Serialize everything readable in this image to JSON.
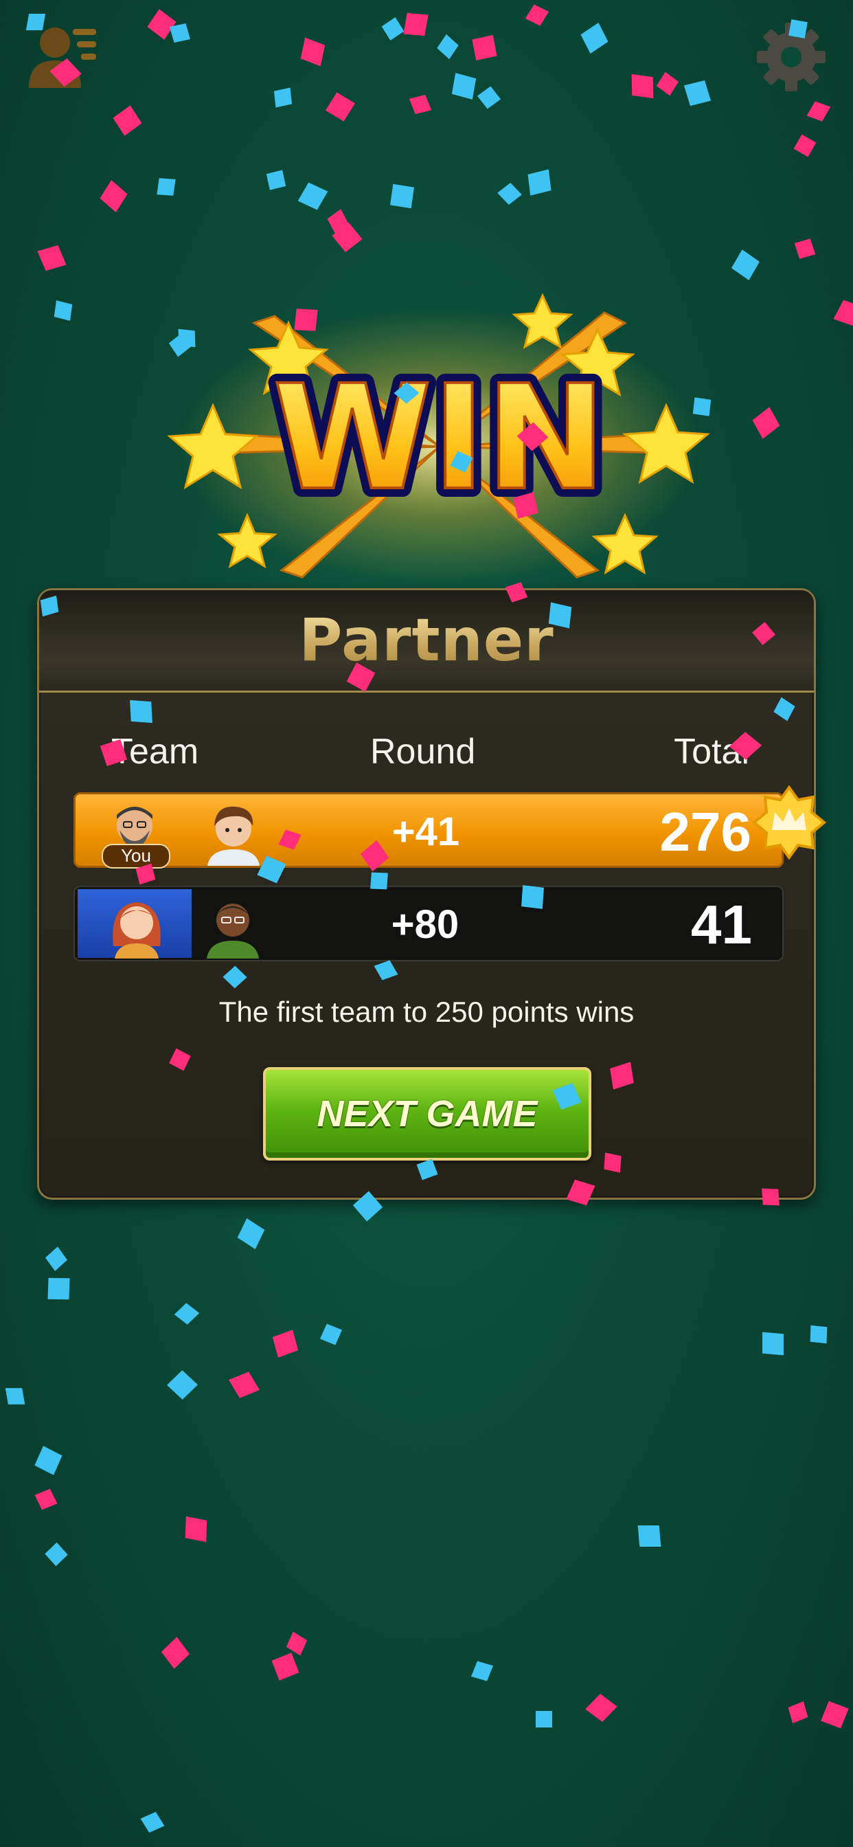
{
  "topbar": {
    "profile_icon": "player-profile-icon",
    "settings_icon": "gear-icon"
  },
  "banner": {
    "text": "WIN"
  },
  "panel": {
    "title": "Partner",
    "columns": {
      "team": "Team",
      "round": "Round",
      "total": "Total"
    },
    "rows": [
      {
        "team_badge": "You",
        "round": "+41",
        "total": "276",
        "winner": true
      },
      {
        "round": "+80",
        "total": "41",
        "winner": false
      }
    ],
    "rule": "The first team to 250 points wins",
    "next_button": "NEXT GAME"
  },
  "colors": {
    "confetti_pink": "#ff2d7a",
    "confetti_blue": "#3fc3f2",
    "winner_row": "#f19400",
    "button_green": "#5eb513"
  }
}
